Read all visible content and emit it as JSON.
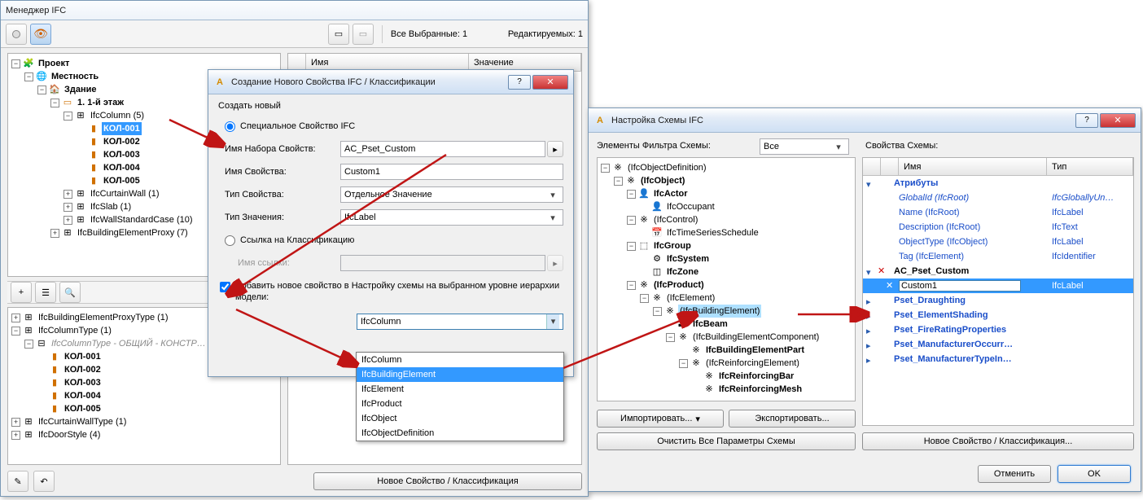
{
  "mgr": {
    "title": "Менеджер IFC",
    "status": {
      "all_selected": "Все Выбранные: 1",
      "editable": "Редактируемых: 1"
    },
    "cols": {
      "name": "Имя",
      "value": "Значение"
    },
    "tree": {
      "project": "Проект",
      "locality": "Местность",
      "building": "Здание",
      "storey": "1. 1-й этаж",
      "ifccolumn": "IfcColumn (5)",
      "col1": "КОЛ-001",
      "col2": "КОЛ-002",
      "col3": "КОЛ-003",
      "col4": "КОЛ-004",
      "col5": "КОЛ-005",
      "curtain": "IfcCurtainWall (1)",
      "slab": "IfcSlab (1)",
      "wall": "IfcWallStandardCase (10)",
      "proxy": "IfcBuildingElementProxy (7)"
    },
    "tree2": {
      "proxytype": "IfcBuildingElementProxyType (1)",
      "coltype": "IfcColumnType (1)",
      "coltype_child": "IfcColumnType - ОБЩИЙ - КОНСТР…",
      "col1": "КОЛ-001",
      "col2": "КОЛ-002",
      "col3": "КОЛ-003",
      "col4": "КОЛ-004",
      "col5": "КОЛ-005",
      "curtainwalltype": "IfcCurtainWallType (1)",
      "doorstyle": "IfcDoorStyle (4)"
    },
    "new_prop_btn": "Новое Свойство / Классификация"
  },
  "dlg": {
    "title": "Создание Нового Свойства IFC / Классификации",
    "create_new": "Создать новый",
    "radio_custom": "Специальное Свойство IFC",
    "pset_name_lbl": "Имя Набора Свойств:",
    "pset_name_val": "AC_Pset_Custom",
    "prop_name_lbl": "Имя Свойства:",
    "prop_name_val": "Custom1",
    "prop_type_lbl": "Тип Свойства:",
    "prop_type_val": "Отдельное Значение",
    "val_type_lbl": "Тип Значения:",
    "val_type_val": "IfcLabel",
    "radio_class": "Ссылка на Классификацию",
    "ref_name_lbl": "Имя ссылки:",
    "chk_lbl": "Добавить новое свойство в Настройку схемы на выбранном уровне иерархии модели:",
    "sel_val": "IfcColumn",
    "options": [
      "IfcColumn",
      "IfcBuildingElement",
      "IfcElement",
      "IfcProduct",
      "IfcObject",
      "IfcObjectDefinition"
    ]
  },
  "scheme": {
    "title": "Настройка Схемы IFC",
    "filter_lbl": "Элементы Фильтра Схемы:",
    "filter_val": "Все",
    "props_lbl": "Свойства Схемы:",
    "tree": {
      "objdef": "(IfcObjectDefinition)",
      "ifcobject": "(IfcObject)",
      "ifcactor": "IfcActor",
      "ifcoccupant": "IfcOccupant",
      "ifccontrol": "(IfcControl)",
      "ifctimeseries": "IfcTimeSeriesSchedule",
      "ifcgroup": "IfcGroup",
      "ifcsystem": "IfcSystem",
      "ifczone": "IfcZone",
      "ifcproduct": "(IfcProduct)",
      "ifcelement": "(IfcElement)",
      "ifcbuildel": "(IfcBuildingElement)",
      "ifcbeam": "IfcBeam",
      "ifcbuildelcomp": "(IfcBuildingElementComponent)",
      "ifcbuildelpart": "IfcBuildingElementPart",
      "ifcreinfel": "(IfcReinforcingElement)",
      "ifcreinfbar": "IfcReinforcingBar",
      "ifcreinfmesh": "IfcReinforcingMesh"
    },
    "import_btn": "Импортировать...",
    "export_btn": "Экспортировать...",
    "clear_btn": "Очистить Все Параметры Схемы",
    "cols": {
      "name": "Имя",
      "type": "Тип"
    },
    "attrs_hdr": "Атрибуты",
    "attrs": [
      {
        "n": "GlobalId (IfcRoot)",
        "t": "IfcGloballyUn…"
      },
      {
        "n": "Name (IfcRoot)",
        "t": "IfcLabel"
      },
      {
        "n": "Description (IfcRoot)",
        "t": "IfcText"
      },
      {
        "n": "ObjectType (IfcObject)",
        "t": "IfcLabel"
      },
      {
        "n": "Tag (IfcElement)",
        "t": "IfcIdentifier"
      }
    ],
    "pset_custom": "AC_Pset_Custom",
    "custom1": "Custom1",
    "custom1_type": "IfcLabel",
    "psets": [
      "Pset_Draughting",
      "Pset_ElementShading",
      "Pset_FireRatingProperties",
      "Pset_ManufacturerOccurr…",
      "Pset_ManufacturerTypeIn…"
    ],
    "new_prop_btn": "Новое Свойство / Классификация...",
    "cancel": "Отменить",
    "ok": "OK"
  }
}
